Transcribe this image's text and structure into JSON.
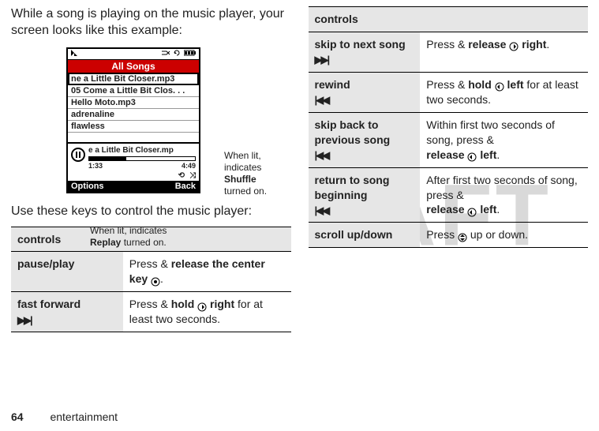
{
  "intro": "While a song is playing on the music player, your screen looks like this example:",
  "phone": {
    "title": "All Songs",
    "songs": [
      "ne a Little Bit Closer.mp3",
      "05 Come a Little Bit Clos. . .",
      "Hello Moto.mp3",
      "adrenaline",
      "flawless"
    ],
    "nowplaying_title": "e a Little Bit Closer.mp",
    "time_elapsed": "1:33",
    "time_total": "4:49",
    "softkey_left": "Options",
    "softkey_right": "Back"
  },
  "callout_shuffle_line1": "When lit, indicates",
  "callout_shuffle_bold": "Shuffle",
  "callout_shuffle_line2": "turned on.",
  "callout_replay_line1": "When lit, indicates",
  "callout_replay_bold": "Replay",
  "callout_replay_line2": "turned on.",
  "use_keys": "Use these keys to control the music player:",
  "controls_header": "controls",
  "left_rows": [
    {
      "label": "pause/play",
      "icon": "",
      "desc_pre": "Press & ",
      "desc_bold": "release the center key",
      "desc_post": " ",
      "nav_icon": "center",
      "desc_post2": "."
    },
    {
      "label": "fast forward",
      "icon": "▶▶|",
      "desc_pre": "Press & ",
      "desc_bold": "hold",
      "desc_post": " ",
      "nav_icon": "right",
      "nav_bold": "right",
      "desc_post2": " for at least two seconds."
    }
  ],
  "right_rows": [
    {
      "label": "skip to next song",
      "icon": "▶▶|",
      "desc_pre": "Press & ",
      "desc_bold": "release",
      "desc_post": " ",
      "nav_icon": "right",
      "nav_bold": "right",
      "desc_post2": "."
    },
    {
      "label": "rewind",
      "icon": "|◀◀",
      "desc_pre": "Press & ",
      "desc_bold": "hold",
      "desc_post": " ",
      "nav_icon": "left",
      "nav_bold": "left",
      "desc_post2": " for at least two seconds."
    },
    {
      "label": "skip back to previous song",
      "icon": "|◀◀",
      "desc_pre": "Within first two seconds of song, press & ",
      "desc_bold": "release",
      "desc_post": " ",
      "nav_icon": "left",
      "nav_bold": "left",
      "desc_post2": "."
    },
    {
      "label": "return to song beginning",
      "icon": "|◀◀",
      "desc_pre": "After first two seconds of song, press & ",
      "desc_bold": "release",
      "desc_post": " ",
      "nav_icon": "left",
      "nav_bold": "left",
      "desc_post2": "."
    },
    {
      "label": "scroll up/down",
      "icon": "",
      "desc_pre": "Press ",
      "desc_bold": "",
      "desc_post": "",
      "nav_icon": "updown",
      "nav_bold": "",
      "desc_post2": " up or down."
    }
  ],
  "footer": {
    "page": "64",
    "section": "entertainment"
  }
}
